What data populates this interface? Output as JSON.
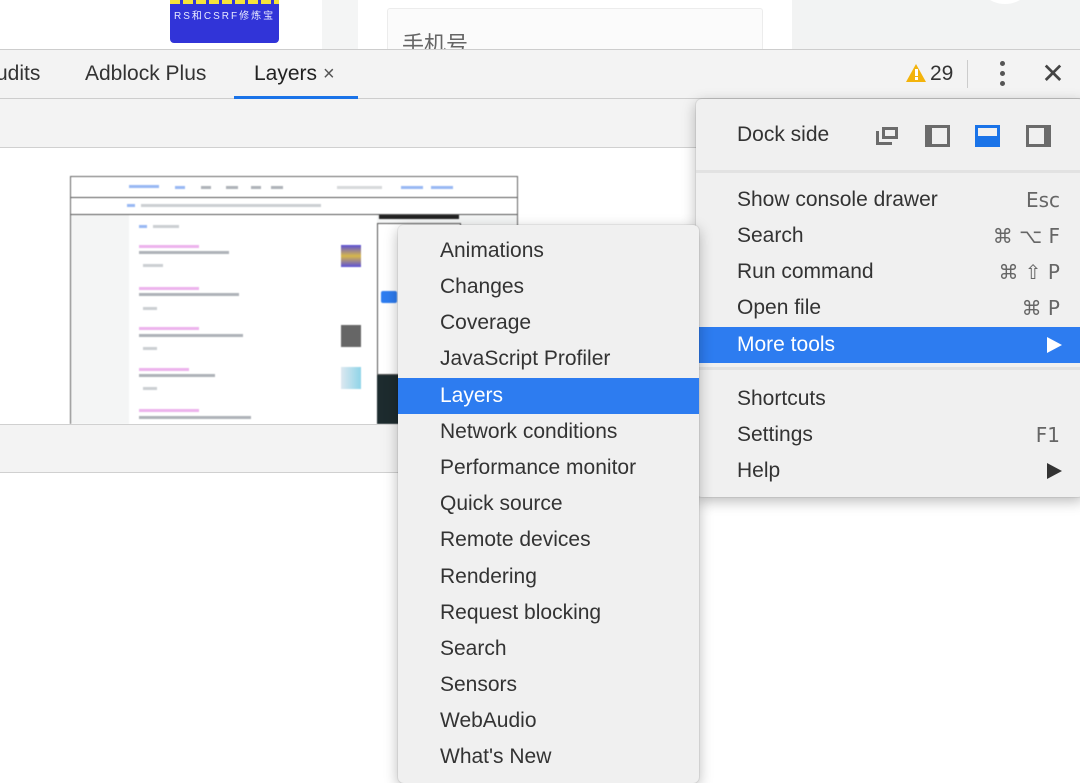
{
  "page_behind": {
    "banner_text": "RS和CSRF修炼宝",
    "phone_placeholder": "手机号"
  },
  "devtools": {
    "tabs": [
      {
        "label": "udits",
        "active": false
      },
      {
        "label": "Adblock Plus",
        "active": false
      },
      {
        "label": "Layers",
        "active": true,
        "closable": true,
        "close_glyph": "×"
      }
    ],
    "warnings_count": "29",
    "accent_color": "#1a73e8",
    "close_glyph": "✕"
  },
  "main_menu": {
    "dock_side_label": "Dock side",
    "dock_options": [
      {
        "name": "undock",
        "active": false
      },
      {
        "name": "dock-left",
        "active": false
      },
      {
        "name": "dock-bottom",
        "active": true
      },
      {
        "name": "dock-right",
        "active": false
      }
    ],
    "items": [
      {
        "label": "Show console drawer",
        "shortcut": "Esc"
      },
      {
        "label": "Search",
        "shortcut": "⌘ ⌥ F"
      },
      {
        "label": "Run command",
        "shortcut": "⌘ ⇧ P"
      },
      {
        "label": "Open file",
        "shortcut": "⌘ P"
      },
      {
        "label": "More tools",
        "submenu": true,
        "highlighted": true
      }
    ],
    "items2": [
      {
        "label": "Shortcuts"
      },
      {
        "label": "Settings",
        "shortcut": "F1"
      },
      {
        "label": "Help",
        "submenu": true
      }
    ],
    "highlight_color": "#2d7cf0"
  },
  "more_tools_menu": {
    "items": [
      {
        "label": "Animations"
      },
      {
        "label": "Changes"
      },
      {
        "label": "Coverage"
      },
      {
        "label": "JavaScript Profiler"
      },
      {
        "label": "Layers",
        "highlighted": true
      },
      {
        "label": "Network conditions"
      },
      {
        "label": "Performance monitor"
      },
      {
        "label": "Quick source"
      },
      {
        "label": "Remote devices"
      },
      {
        "label": "Rendering"
      },
      {
        "label": "Request blocking"
      },
      {
        "label": "Search"
      },
      {
        "label": "Sensors"
      },
      {
        "label": "WebAudio"
      },
      {
        "label": "What's New"
      }
    ]
  }
}
